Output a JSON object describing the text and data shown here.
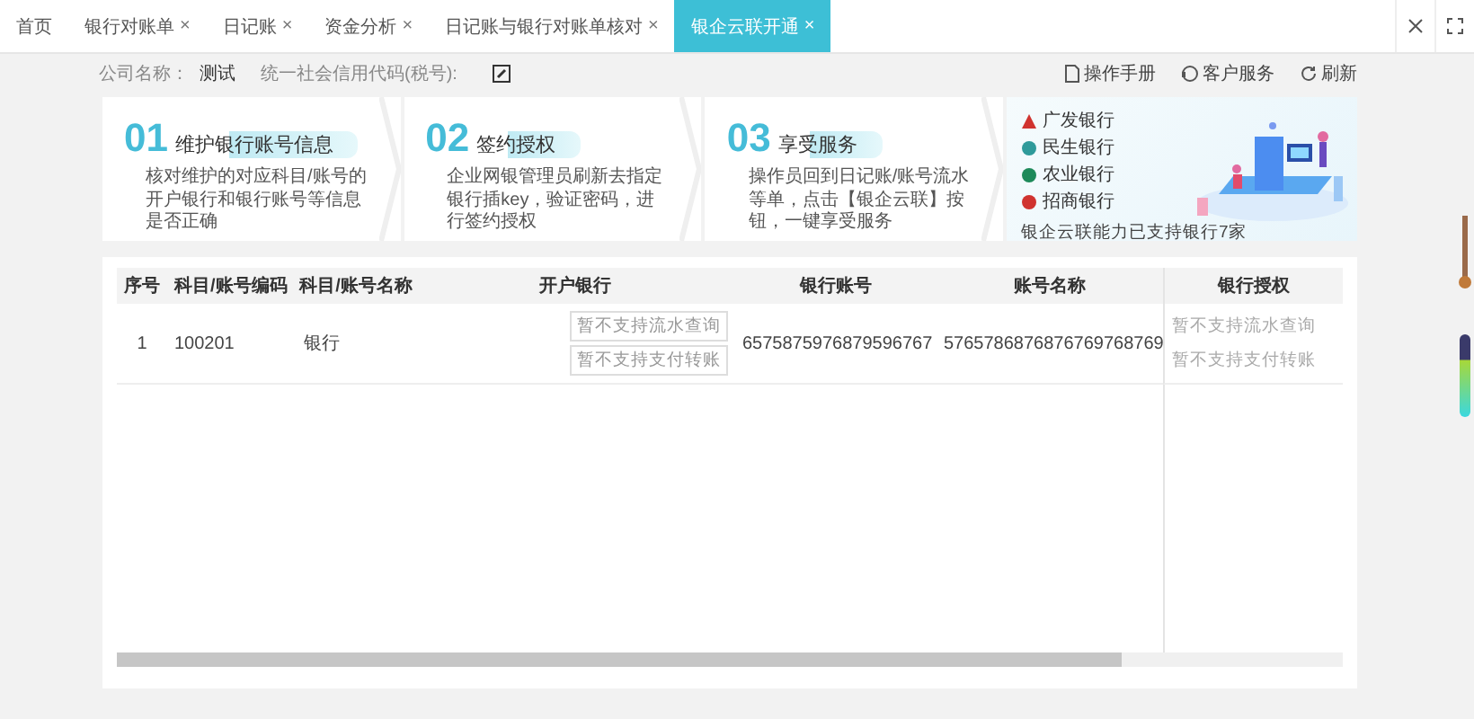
{
  "tabs": [
    {
      "label": "首页",
      "closable": false,
      "selected": false
    },
    {
      "label": "银行对账单",
      "closable": true,
      "selected": false
    },
    {
      "label": "日记账",
      "closable": true,
      "selected": false
    },
    {
      "label": "资金分析",
      "closable": true,
      "selected": false
    },
    {
      "label": "日记账与银行对账单核对",
      "closable": true,
      "selected": false
    },
    {
      "label": "银企云联开通",
      "closable": true,
      "selected": true
    }
  ],
  "tab_close_glyph": "×",
  "info_bar": {
    "company_label": "公司名称：",
    "company_name": "测试",
    "tax_label": "统一社会信用代码(税号):",
    "links": [
      "操作手册",
      "客户服务",
      "刷新"
    ]
  },
  "steps": [
    {
      "number": "01",
      "title": "维护银行账号信息",
      "text": "核对维护的对应科目/账号的开户银行和银行账号等信息是否正确"
    },
    {
      "number": "02",
      "title": "签约授权",
      "text": "企业网银管理员刷新去指定银行插key，验证密码，进行签约授权"
    },
    {
      "number": "03",
      "title": "享受服务",
      "text": "操作员回到日记账/账号流水等单，点击【银企云联】按钮，一键享受服务"
    }
  ],
  "banks": [
    {
      "name": "广发银行",
      "color": "#d0332f"
    },
    {
      "name": "民生银行",
      "color": "#2f9a9a"
    },
    {
      "name": "农业银行",
      "color": "#1e8a5a"
    },
    {
      "name": "招商银行",
      "color": "#d0332f"
    }
  ],
  "banks_note": "银企云联能力已支持银行7家",
  "table": {
    "columns": [
      "序号",
      "科目/账号编码",
      "科目/账号名称",
      "开户银行",
      "银行账号",
      "账号名称",
      "银行授权"
    ],
    "rows": [
      {
        "index": "1",
        "code": "100201",
        "name": "银行",
        "bank_tags": [
          "暂不支持流水查询",
          "暂不支持支付转账"
        ],
        "account": "6575875976879596767",
        "account_name": "5765786876876769768769",
        "auth_tags": [
          "暂不支持流水查询",
          "暂不支持支付转账"
        ]
      }
    ]
  }
}
